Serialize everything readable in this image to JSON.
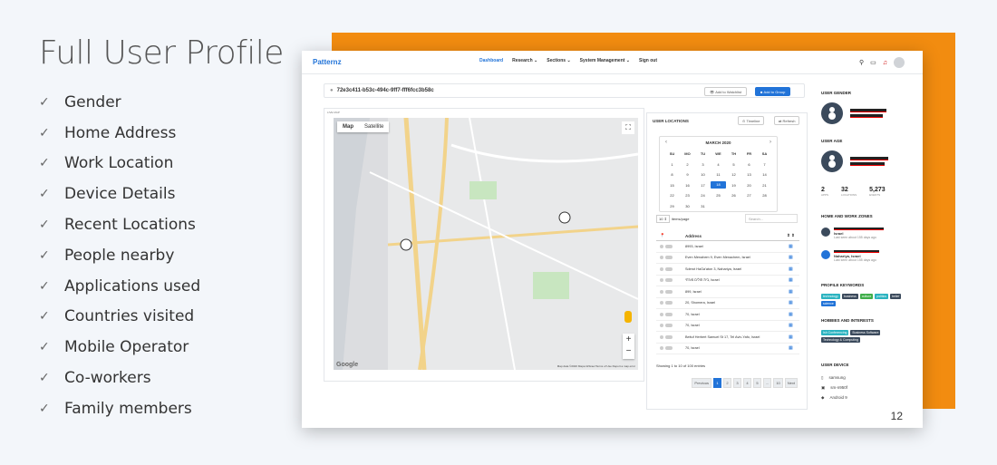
{
  "slide": {
    "title": "Full User Profile",
    "features": [
      "Gender",
      "Home Address",
      "Work Location",
      "Device Details",
      "Recent Locations",
      "People nearby",
      "Applications used",
      "Countries visited",
      "Mobile Operator",
      "Co-workers",
      "Family members"
    ],
    "page_number": "12"
  },
  "app": {
    "logo": "Patternz",
    "nav": [
      "Dashboard",
      "Research",
      "Sections",
      "System Management",
      "Sign out"
    ],
    "accent": "#2173d8"
  },
  "idbar": {
    "user_id": "72e3c411-b53c-494c-9ff7-fff6fcc3b58c",
    "watchlist": "Add to Watchlist",
    "group": "Add to Group"
  },
  "map": {
    "small_label": "LIVE MAP",
    "tab_map": "Map",
    "tab_satellite": "Satellite",
    "google": "Google",
    "attribution": "Map data ©2020 Mapa GISrael  Terms of Use  Report a map error"
  },
  "locations": {
    "title": "USER LOCATIONS",
    "timeline": "Timeline",
    "refresh": "Refresh",
    "calendar_month": "MARCH 2020",
    "weekdays": [
      "SU",
      "MO",
      "TU",
      "WE",
      "TH",
      "FR",
      "SA"
    ],
    "weeks": [
      [
        "1",
        "2",
        "3",
        "4",
        "5",
        "6",
        "7"
      ],
      [
        "8",
        "9",
        "10",
        "11",
        "12",
        "13",
        "14"
      ],
      [
        "15",
        "16",
        "17",
        "18",
        "19",
        "20",
        "21"
      ],
      [
        "22",
        "23",
        "24",
        "25",
        "26",
        "27",
        "28"
      ],
      [
        "29",
        "30",
        "31",
        "",
        "",
        "",
        ""
      ]
    ],
    "selected_day": "18",
    "per_page": "10",
    "per_page_label": "items/page",
    "search_placeholder": "Search...",
    "col_address": "Address",
    "rows": [
      "8993, Israel",
      "Even Menahem 9, Even Menachem, Israel",
      "Sderot HaGa'aton 3, Nahariya, Israel",
      "בית חולים מזרחי, Israel",
      "899, Israel",
      "20, Shomera, Israel",
      "70, Israel",
      "70, Israel",
      "Beituf Herbert Samuel St 17, Tel Aviv-Yafo, Israel",
      "70, Israel"
    ],
    "showing": "Showing 1 to 10 of 100 entries",
    "pages": [
      "Previous",
      "1",
      "2",
      "3",
      "4",
      "5",
      "...",
      "10",
      "Next"
    ]
  },
  "profile": {
    "gender_title": "USER GENDER",
    "age_title": "USER AGE",
    "stats": [
      {
        "value": "2",
        "label": "APPS"
      },
      {
        "value": "32",
        "label": "LOCATIONS"
      },
      {
        "value": "5,273",
        "label": "EVENTS"
      }
    ],
    "zones_title": "HOME AND WORK ZONES",
    "zones": [
      {
        "name": "Israel",
        "seen": "Last seen about 155 days ago"
      },
      {
        "name": "Nahariya, Israel",
        "seen": "Last seen about 155 days ago"
      }
    ],
    "keywords_title": "PROFILE KEYWORDS",
    "keywords": [
      {
        "t": "technology",
        "c": "#2bb3c0"
      },
      {
        "t": "business",
        "c": "#3b4a5c"
      },
      {
        "t": "culture",
        "c": "#3fae49"
      },
      {
        "t": "politics",
        "c": "#2bb3c0"
      },
      {
        "t": "belief",
        "c": "#3b4a5c"
      },
      {
        "t": "science",
        "c": "#2173d8"
      }
    ],
    "hobbies_title": "HOBBIES AND INTERESTS",
    "hobbies": [
      {
        "t": "Ish Conferencing",
        "c": "#2bb3c0"
      },
      {
        "t": "Business Software",
        "c": "#3b4a5c"
      },
      {
        "t": "Technology & Computing",
        "c": "#3b4a5c"
      }
    ],
    "device_title": "USER DEVICE",
    "device": [
      "samsung",
      "sm-n950f",
      "Android 9"
    ]
  }
}
